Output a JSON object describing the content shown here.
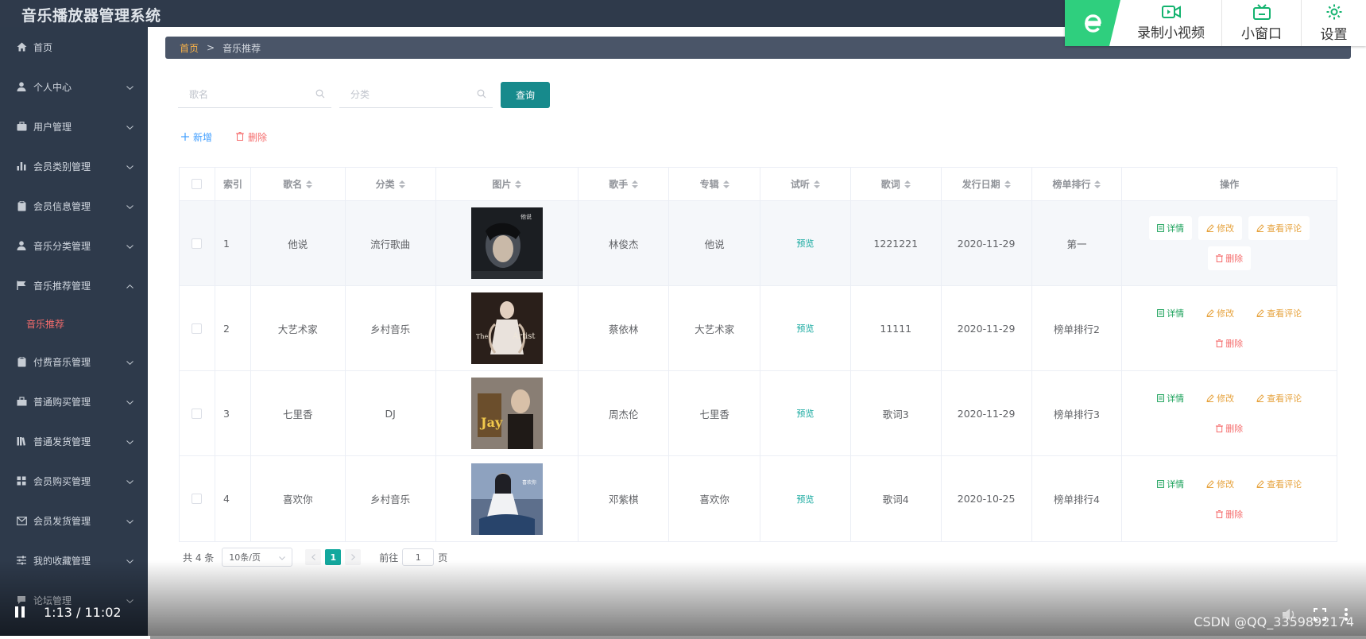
{
  "app": {
    "title": "音乐播放器管理系统"
  },
  "colors": {
    "sidebar_bg": "#2e3a4b",
    "accent_teal": "#178a8c",
    "active_menu": "#f56c6c",
    "breadcrumb_home": "#f5b049"
  },
  "sidebar": {
    "items": [
      {
        "label": "首页",
        "icon": "home-icon",
        "chev": ""
      },
      {
        "label": "个人中心",
        "icon": "user-icon",
        "chev": "down"
      },
      {
        "label": "用户管理",
        "icon": "briefcase-icon",
        "chev": "down"
      },
      {
        "label": "会员类别管理",
        "icon": "bar-chart-icon",
        "chev": "down"
      },
      {
        "label": "会员信息管理",
        "icon": "clipboard-icon",
        "chev": "down"
      },
      {
        "label": "音乐分类管理",
        "icon": "user-icon",
        "chev": "down"
      },
      {
        "label": "音乐推荐管理",
        "icon": "flag-icon",
        "chev": "up"
      },
      {
        "label": "付费音乐管理",
        "icon": "clipboard-icon",
        "chev": "down"
      },
      {
        "label": "普通购买管理",
        "icon": "toolbox-icon",
        "chev": "down"
      },
      {
        "label": "普通发货管理",
        "icon": "library-icon",
        "chev": "down"
      },
      {
        "label": "会员购买管理",
        "icon": "grid-icon",
        "chev": "down"
      },
      {
        "label": "会员发货管理",
        "icon": "mail-icon",
        "chev": "down"
      },
      {
        "label": "我的收藏管理",
        "icon": "sliders-icon",
        "chev": "down"
      },
      {
        "label": "论坛管理",
        "icon": "forum-icon",
        "chev": "down"
      }
    ],
    "active_sub": "音乐推荐"
  },
  "breadcrumb": {
    "home": "首页",
    "sep": ">",
    "current": "音乐推荐"
  },
  "search": {
    "name_placeholder": "歌名",
    "category_placeholder": "分类",
    "query_label": "查询"
  },
  "actions": {
    "add_label": "新增",
    "delete_label": "删除"
  },
  "table": {
    "headers": [
      "索引",
      "歌名",
      "分类",
      "图片",
      "歌手",
      "专辑",
      "试听",
      "歌词",
      "发行日期",
      "榜单排行",
      "操作"
    ],
    "rows": [
      {
        "index": "1",
        "name": "他说",
        "category": "流行歌曲",
        "singer": "林俊杰",
        "album": "他说",
        "trial": "预览",
        "lyrics": "1221221",
        "date": "2020-11-29",
        "rank": "第一"
      },
      {
        "index": "2",
        "name": "大艺术家",
        "category": "乡村音乐",
        "singer": "蔡依林",
        "album": "大艺术家",
        "trial": "预览",
        "lyrics": "11111",
        "date": "2020-11-29",
        "rank": "榜单排行2"
      },
      {
        "index": "3",
        "name": "七里香",
        "category": "DJ",
        "singer": "周杰伦",
        "album": "七里香",
        "trial": "预览",
        "lyrics": "歌词3",
        "date": "2020-11-29",
        "rank": "榜单排行3"
      },
      {
        "index": "4",
        "name": "喜欢你",
        "category": "乡村音乐",
        "singer": "邓紫棋",
        "album": "喜欢你",
        "trial": "预览",
        "lyrics": "歌词4",
        "date": "2020-10-25",
        "rank": "榜单排行4"
      }
    ],
    "ops": {
      "detail": "详情",
      "edit": "修改",
      "comments": "查看评论",
      "delete": "删除"
    }
  },
  "pagination": {
    "total": "共 4 条",
    "page_size": "10条/页",
    "current_page": "1",
    "goto_prefix": "前往",
    "goto_value": "1",
    "goto_suffix": "页"
  },
  "float_toolbar": {
    "record": "录制小视频",
    "mini_window": "小窗口",
    "settings": "设置"
  },
  "video": {
    "time": "1:13 / 11:02",
    "progress": 0.11
  },
  "watermark": "CSDN @QQ_3359892174"
}
